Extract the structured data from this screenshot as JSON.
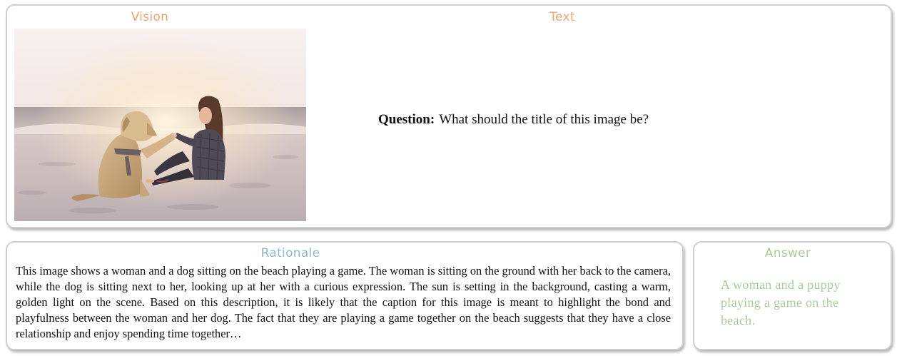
{
  "colors": {
    "vision_heading": "#f0a56e",
    "text_heading": "#f0a56e",
    "rationale_heading": "#8fb7d8",
    "answer_heading": "#a9cd97",
    "answer_text": "#a9cd97"
  },
  "vision": {
    "heading": "Vision",
    "image_description": "photo-beach-woman-and-dog"
  },
  "text": {
    "heading": "Text",
    "question_label": "Question:",
    "question": "What should the title of this image be?"
  },
  "rationale": {
    "heading": "Rationale",
    "body": "This image shows a woman and a dog sitting on the beach playing a game. The woman is sitting on the ground with her back to the camera, while the dog is sitting next to her, looking up at her with a curious expression. The sun is setting in the background, casting a warm, golden light on the scene. Based on this description, it is likely that the caption for this image is meant to highlight the bond and playfulness between the woman and her dog. The fact that they are playing a game together on the beach suggests that they have a close relationship and enjoy spending time together…"
  },
  "answer": {
    "heading": "Answer",
    "body": "A woman and a puppy playing a game on the beach."
  }
}
